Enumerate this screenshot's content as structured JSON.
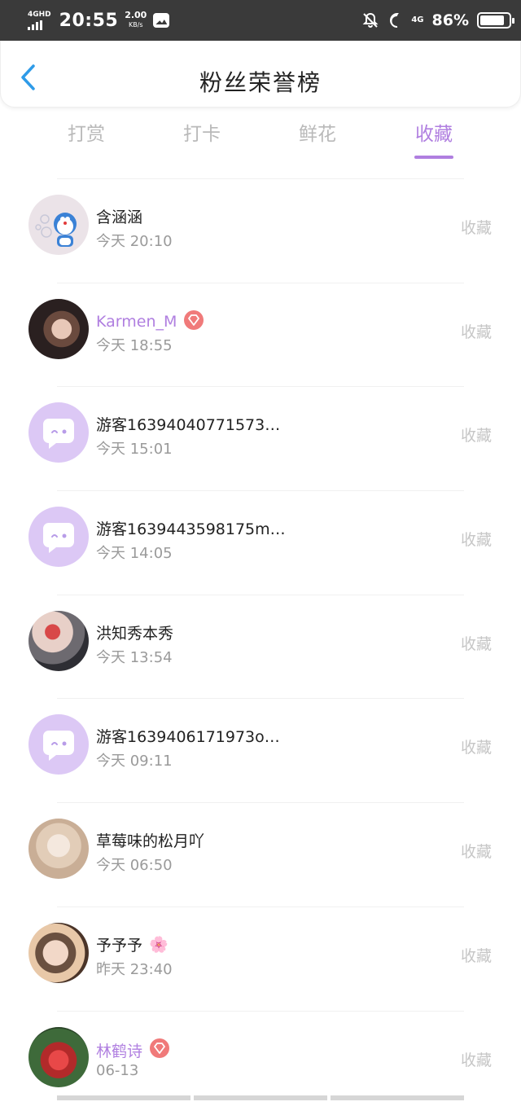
{
  "status_bar": {
    "network_label": "4GHD",
    "time": "20:55",
    "speed_value": "2.00",
    "speed_unit": "KB/s",
    "net2_label": "4G",
    "battery": "86%",
    "battery_level": 0.86
  },
  "header": {
    "title": "粉丝荣誉榜"
  },
  "tabs": [
    {
      "label": "打赏",
      "active": false
    },
    {
      "label": "打卡",
      "active": false
    },
    {
      "label": "鲜花",
      "active": false
    },
    {
      "label": "收藏",
      "active": true
    }
  ],
  "list": [
    {
      "name": "含涵涵",
      "date": "今天 20:10",
      "action": "收藏",
      "avatar": "doraemon",
      "vip": false
    },
    {
      "name": "Karmen_M",
      "date": "今天 18:55",
      "action": "收藏",
      "avatar": "photo-dark",
      "vip": true
    },
    {
      "name": "游客16394040771573…",
      "date": "今天 15:01",
      "action": "收藏",
      "avatar": "default",
      "vip": false
    },
    {
      "name": "游客1639443598175m…",
      "date": "今天 14:05",
      "action": "收藏",
      "avatar": "default",
      "vip": false
    },
    {
      "name": "洪知秀本秀",
      "date": "今天 13:54",
      "action": "收藏",
      "avatar": "photo-red",
      "vip": false
    },
    {
      "name": "游客1639406171973o…",
      "date": "今天 09:11",
      "action": "收藏",
      "avatar": "default",
      "vip": false
    },
    {
      "name": "草莓味的松月吖",
      "date": "今天 06:50",
      "action": "收藏",
      "avatar": "photo-light",
      "vip": false
    },
    {
      "name": "予予予",
      "date": "昨天 23:40",
      "action": "收藏",
      "avatar": "photo-girl",
      "vip": false,
      "emoji": "🌸"
    },
    {
      "name": "林鹤诗",
      "date": "06-13",
      "action": "收藏",
      "avatar": "photo-red2",
      "vip": true
    }
  ],
  "colors": {
    "accent": "#b07fe0",
    "vip_badge": "#f07a7a",
    "muted": "#c6c6c6",
    "back_icon": "#2e9be8"
  }
}
